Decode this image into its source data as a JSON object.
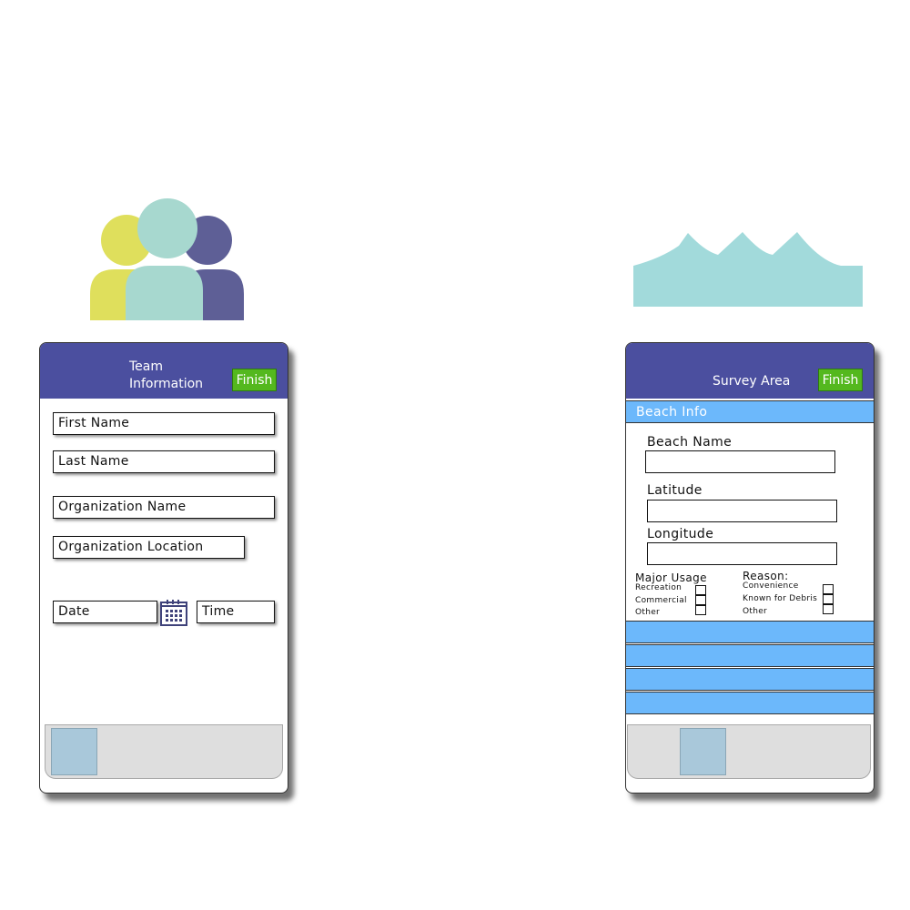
{
  "icons": {
    "team": "people-group-icon",
    "survey": "waves-icon",
    "calendar": "calendar-icon"
  },
  "colors": {
    "header": "#4b4f9f",
    "finish": "#54b81e",
    "section": "#6cb8fb",
    "person_yellow": "#dfdf5c",
    "person_teal": "#a7d8cf",
    "person_purple": "#5e5f96",
    "waves": "#a2dadb",
    "thumb": "#a9c8da"
  },
  "team_screen": {
    "title_line1": "Team",
    "title_line2": "Information",
    "finish_label": "Finish",
    "fields": {
      "first_name": "First Name",
      "last_name": "Last Name",
      "org_name": "Organization Name",
      "org_location": "Organization Location",
      "date": "Date",
      "time": "Time"
    }
  },
  "survey_screen": {
    "title": "Survey Area",
    "finish_label": "Finish",
    "section_title": "Beach Info",
    "beach_name_label": "Beach Name",
    "latitude_label": "Latitude",
    "longitude_label": "Longitude",
    "major_usage": {
      "label": "Major Usage",
      "options": [
        "Recreation",
        "Commercial",
        "Other"
      ]
    },
    "reason": {
      "label": "Reason:",
      "options": [
        "Convenience",
        "Known for Debris",
        "Other"
      ]
    }
  }
}
